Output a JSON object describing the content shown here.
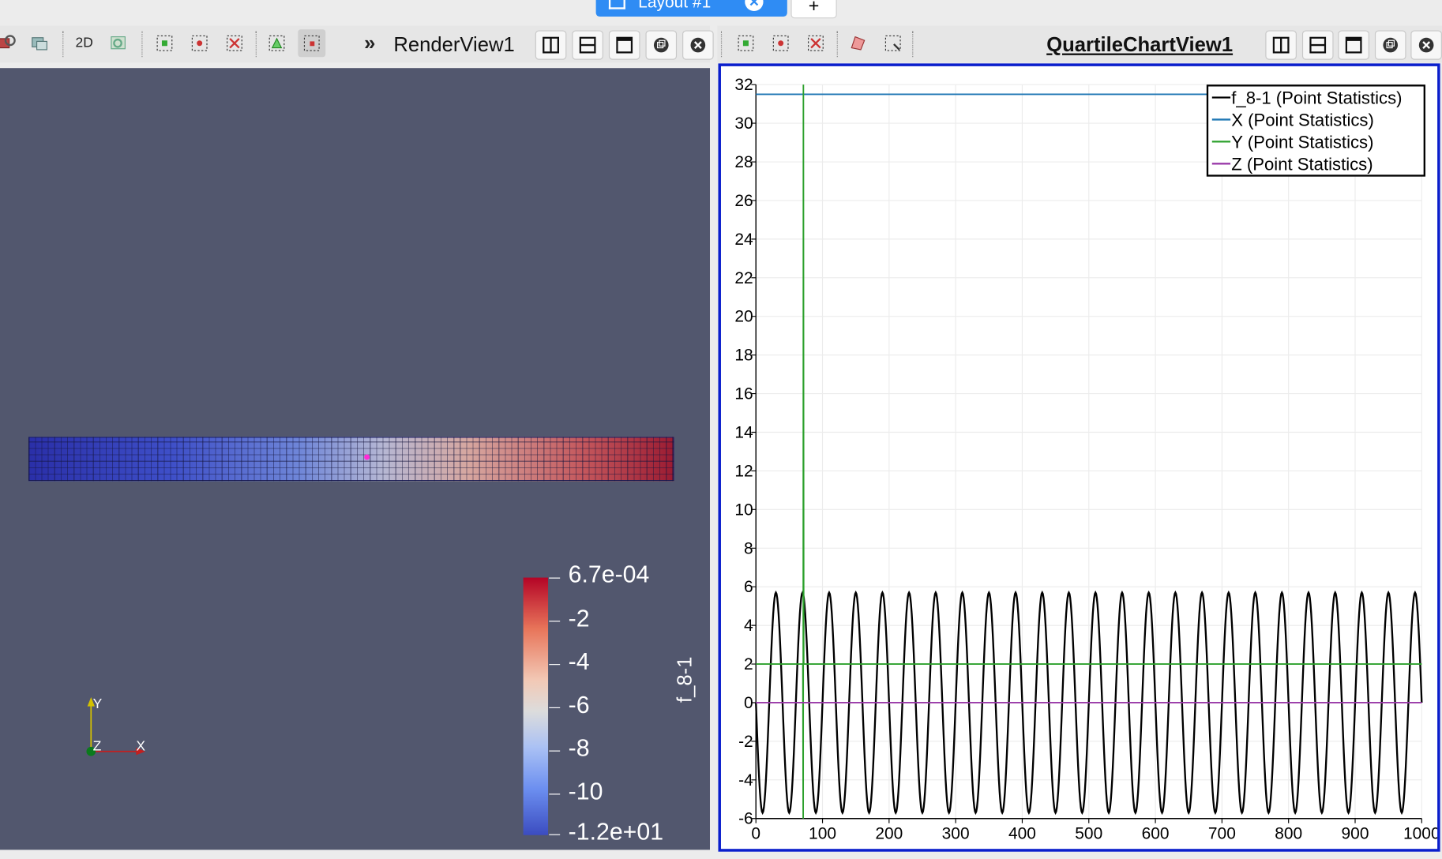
{
  "layout_tab": {
    "label": "Layout #1",
    "add_label": "+"
  },
  "render_view": {
    "toolbar_2d_label": "2D",
    "title": "RenderView1",
    "colorbar": {
      "title": "f_8-1",
      "labels": [
        "6.7e-04",
        "-2",
        "-4",
        "-6",
        "-8",
        "-10",
        "-1.2e+01"
      ]
    },
    "axes": {
      "x": "X",
      "y": "Y",
      "z": "Z"
    }
  },
  "chart_view": {
    "title": "QuartileChartView1"
  },
  "chart_data": {
    "type": "line",
    "xlim": [
      0,
      1000
    ],
    "ylim": [
      -6,
      32
    ],
    "x_ticks": [
      "0",
      "100",
      "200",
      "300",
      "400",
      "500",
      "600",
      "700",
      "800",
      "900",
      "1000"
    ],
    "y_ticks": [
      "-6",
      "-4",
      "-2",
      "0",
      "2",
      "4",
      "6",
      "8",
      "10",
      "12",
      "14",
      "16",
      "18",
      "20",
      "22",
      "24",
      "26",
      "28",
      "30",
      "32"
    ],
    "grid": true,
    "legend_position": "top-right",
    "series": [
      {
        "name": "f_8-1 (Point Statistics)",
        "color": "#000000",
        "kind": "oscillation",
        "amplitude": 5.7,
        "period": 40,
        "x_start": 0,
        "x_end": 1000
      },
      {
        "name": "X (Point Statistics)",
        "color": "#1f77b4",
        "kind": "constant",
        "y": 31.5,
        "x_start": 0,
        "x_end": 1000
      },
      {
        "name": "Y (Point Statistics)",
        "color": "#2ca02c",
        "kind": "constant_with_spike",
        "y": 2,
        "spike_x": 71,
        "spike_low": -6,
        "spike_high": 32,
        "x_start": 0,
        "x_end": 1000
      },
      {
        "name": "Z (Point Statistics)",
        "color": "#9a3aa8",
        "kind": "constant",
        "y": 0,
        "x_start": 0,
        "x_end": 1000
      }
    ]
  }
}
